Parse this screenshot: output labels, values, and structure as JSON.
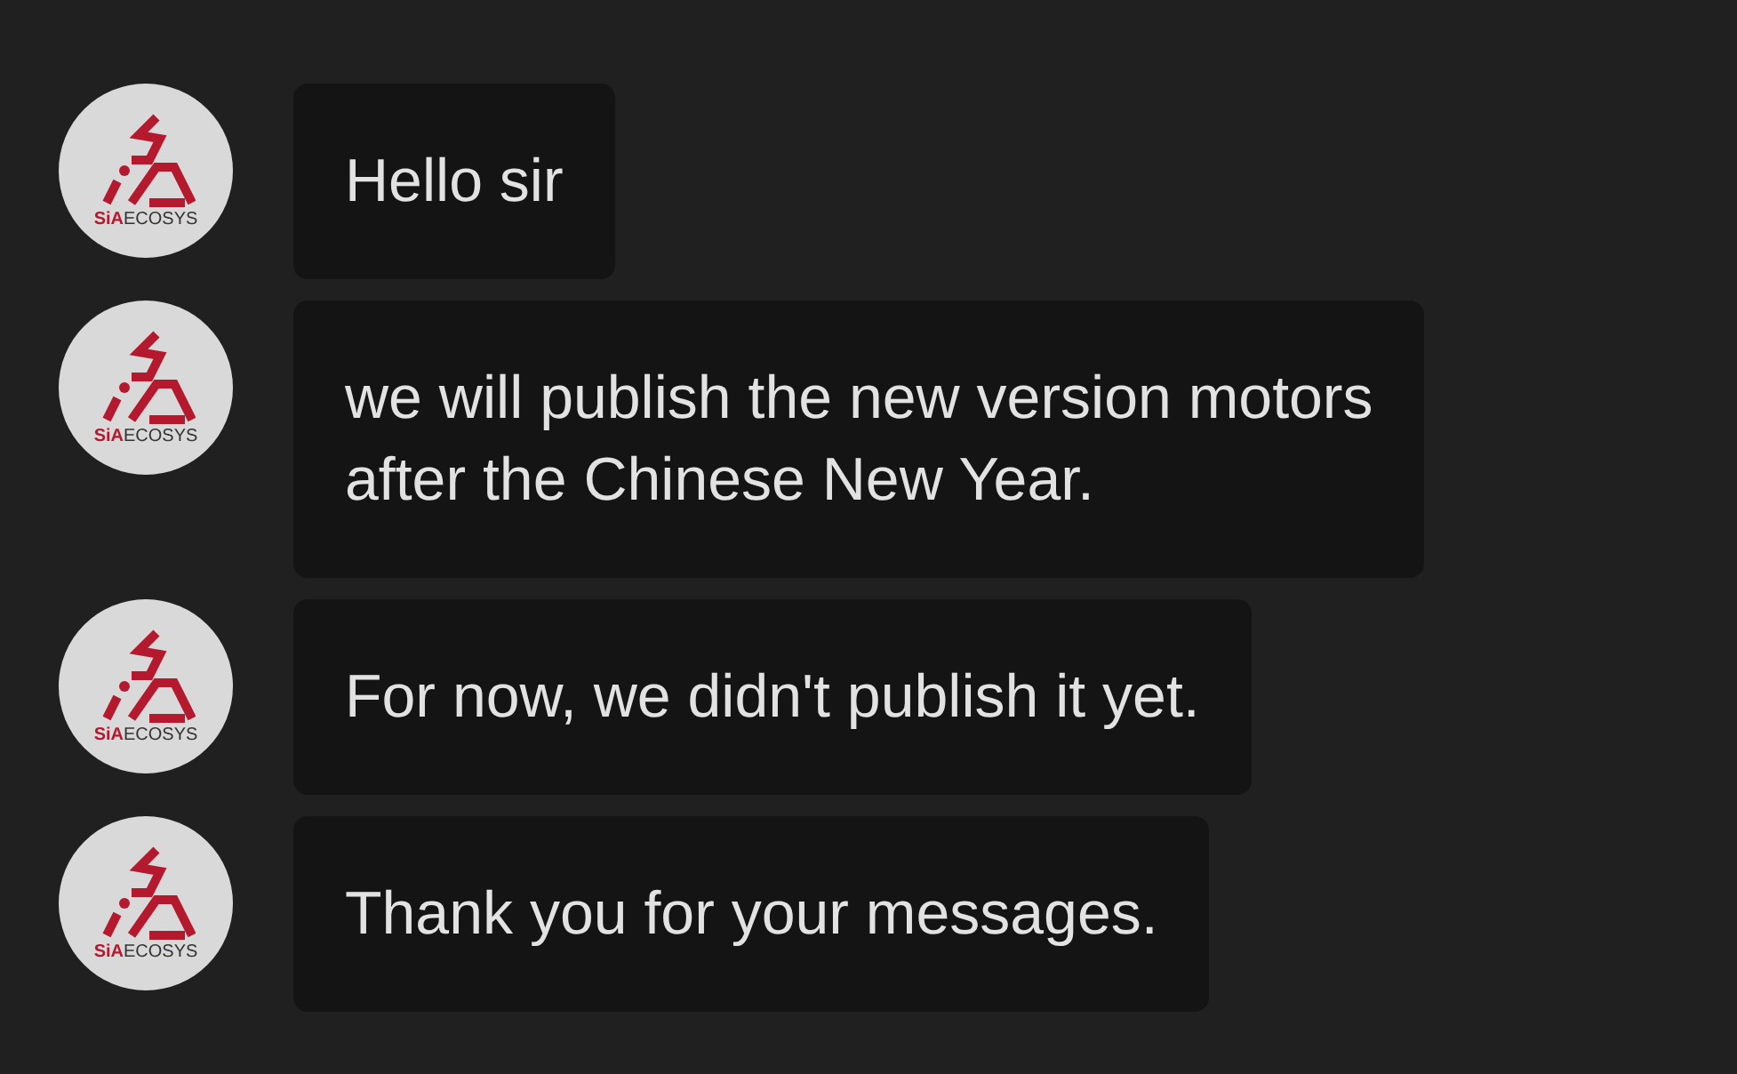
{
  "messages": [
    {
      "avatar": {
        "brand": "SiA",
        "name": "ECOSYS"
      },
      "lines": [
        "Hello sir"
      ]
    },
    {
      "avatar": {
        "brand": "SiA",
        "name": "ECOSYS"
      },
      "lines": [
        "we will publish the new version motors",
        "after the Chinese New Year."
      ]
    },
    {
      "avatar": {
        "brand": "SiA",
        "name": "ECOSYS"
      },
      "lines": [
        "For now, we didn't publish it yet."
      ]
    },
    {
      "avatar": {
        "brand": "SiA",
        "name": "ECOSYS"
      },
      "lines": [
        "Thank you for your messages."
      ]
    }
  ]
}
